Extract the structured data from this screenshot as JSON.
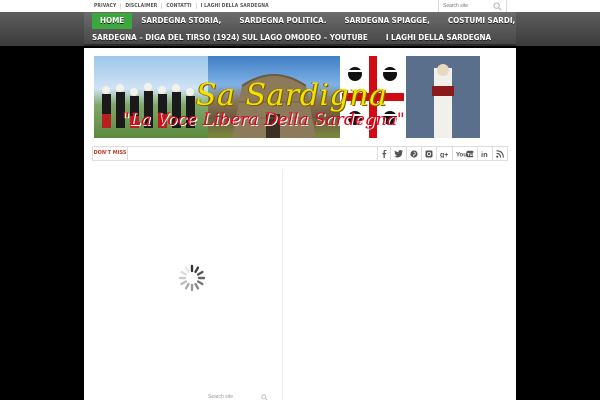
{
  "top_menu": [
    "Privacy",
    "Disclaimer",
    "Contatti",
    "I LAGHI DELLA SARDEGNA"
  ],
  "search": {
    "placeholder": "Search site"
  },
  "main_menu": {
    "row1": [
      "Home",
      "Sardegna storia,",
      "Sardegna politica.",
      "Sardegna spiagge,",
      "Costumi sardi,"
    ],
    "row2": [
      "Sardegna – Diga del Tirso (1924) sul lago Omodeo – YouTube",
      "I LAGHI DELLA SARDEGNA"
    ]
  },
  "banner": {
    "title": "Sa Sardigna",
    "subtitle": "\"La Voce Libera Della Sardegna\""
  },
  "dont_miss": {
    "label": "Don't Miss"
  },
  "social_icons": [
    "facebook-icon",
    "twitter-icon",
    "pinterest-icon",
    "instagram-icon",
    "googleplus-icon",
    "youtube-icon",
    "linkedin-icon",
    "rss-icon"
  ],
  "bottom": {
    "search_placeholder": "Search site"
  },
  "colors": {
    "accent": "#3aa83c",
    "nav_bg": "#555555",
    "label_red": "#c0392b"
  }
}
